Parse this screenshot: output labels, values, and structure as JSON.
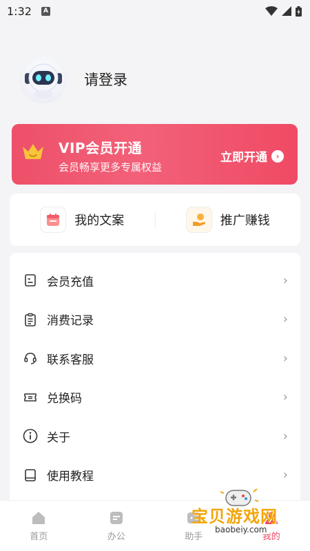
{
  "status_bar": {
    "time": "1:32",
    "notification_letter": "A"
  },
  "profile": {
    "login_text": "请登录"
  },
  "vip": {
    "title": "VIP会员开通",
    "subtitle": "会员畅享更多专属权益",
    "open_label": "立即开通",
    "accent": "#f04a64"
  },
  "quick_actions": [
    {
      "label": "我的文案",
      "icon": "calendar-icon"
    },
    {
      "label": "推广赚钱",
      "icon": "money-hand-icon"
    }
  ],
  "menu": [
    {
      "label": "会员充值",
      "icon": "document-icon"
    },
    {
      "label": "消费记录",
      "icon": "clipboard-icon"
    },
    {
      "label": "联系客服",
      "icon": "headset-icon"
    },
    {
      "label": "兑换码",
      "icon": "ticket-icon"
    },
    {
      "label": "关于",
      "icon": "info-icon"
    },
    {
      "label": "使用教程",
      "icon": "book-icon"
    }
  ],
  "bottom_nav": [
    {
      "label": "首页",
      "icon": "home-icon"
    },
    {
      "label": "办公",
      "icon": "office-icon"
    },
    {
      "label": "助手",
      "icon": "assistant-icon"
    },
    {
      "label": "我的",
      "icon": "profile-icon",
      "active": true
    }
  ],
  "watermark": {
    "title": "宝贝游戏网",
    "url": "baobeiy.com"
  }
}
